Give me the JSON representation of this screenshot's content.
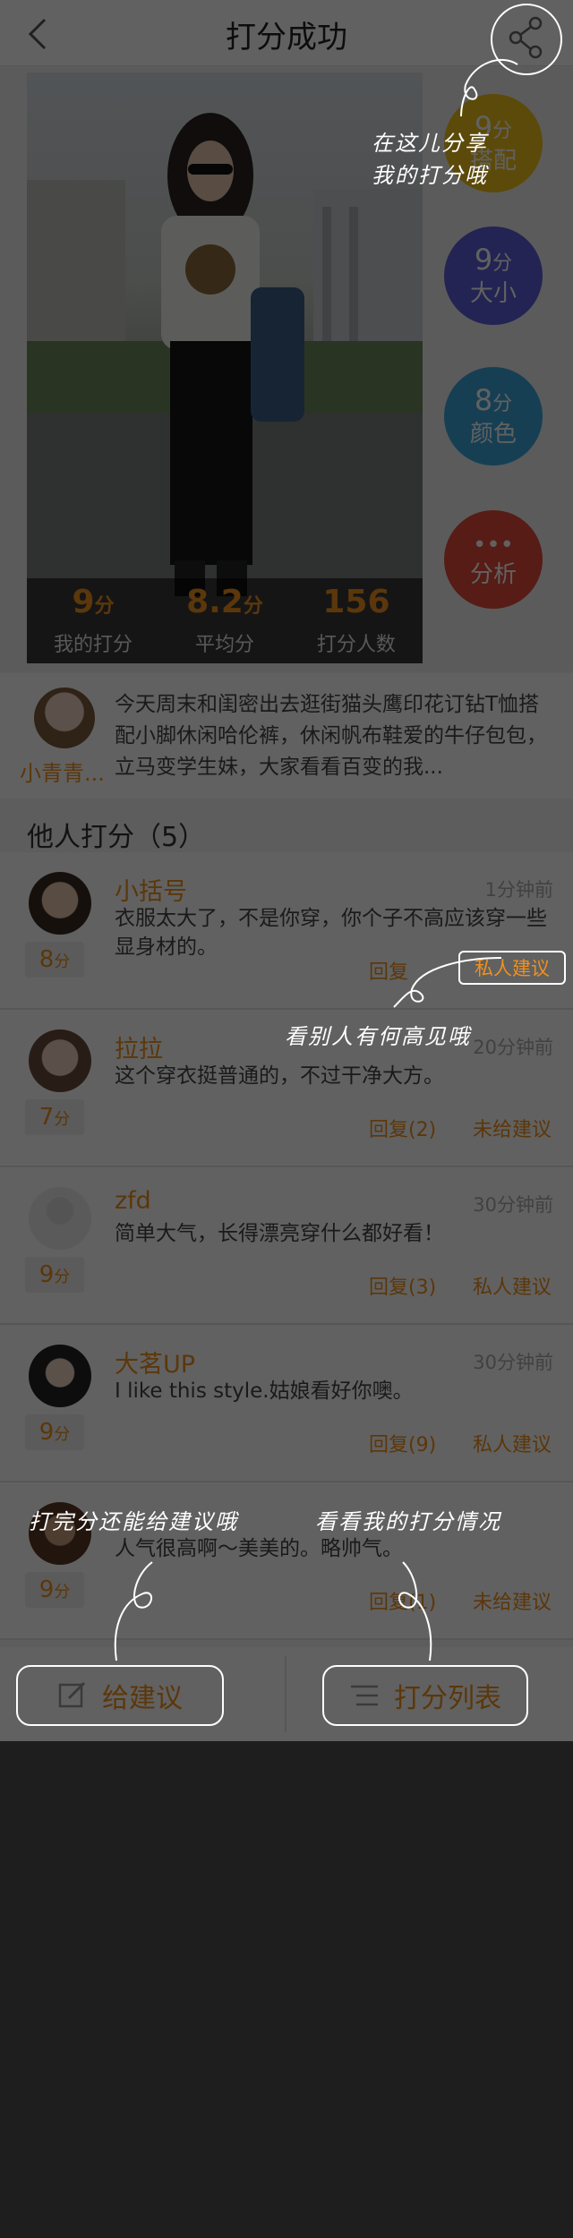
{
  "header": {
    "title": "打分成功"
  },
  "scores": [
    {
      "value": "9",
      "unit": "分",
      "label": "我的打分"
    },
    {
      "value": "8.2",
      "unit": "分",
      "label": "平均分"
    },
    {
      "value": "156",
      "unit": "",
      "label": "打分人数"
    }
  ],
  "side_scores": [
    {
      "value": "9",
      "unit": "分",
      "caption": "搭配",
      "color": "#f2c21b"
    },
    {
      "value": "9",
      "unit": "分",
      "caption": "大小",
      "color": "#5c60d9"
    },
    {
      "value": "8",
      "unit": "分",
      "caption": "颜色",
      "color": "#3ea5dc"
    },
    {
      "value": "•••",
      "unit": "",
      "caption": "分析",
      "color": "#e14a38"
    }
  ],
  "poster": {
    "name": "小青青...",
    "description": "今天周末和闺密出去逛街猫头鹰印花订钻T恤搭配小脚休闲哈伦裤，休闲帆布鞋爱的牛仔包包，立马变学生妹，大家看看百变的我..."
  },
  "section": {
    "title": "他人打分（5）"
  },
  "comments": [
    {
      "name": "小括号",
      "time": "1分钟前",
      "score": "8",
      "unit": "分",
      "text": "衣服太大了，不是你穿，你个子不高应该穿一些显身材的。",
      "reply": "回复",
      "advice": "私人建议"
    },
    {
      "name": "拉拉",
      "time": "20分钟前",
      "score": "7",
      "unit": "分",
      "text": "这个穿衣挺普通的，不过干净大方。",
      "reply": "回复(2)",
      "advice": "未给建议"
    },
    {
      "name": "zfd",
      "time": "30分钟前",
      "score": "9",
      "unit": "分",
      "text": "简单大气，长得漂亮穿什么都好看！",
      "reply": "回复(3)",
      "advice": "私人建议"
    },
    {
      "name": "大茗UP",
      "time": "30分钟前",
      "score": "9",
      "unit": "分",
      "text": "I like this style.姑娘看好你噢。",
      "reply": "回复(9)",
      "advice": "私人建议"
    },
    {
      "name": "",
      "time": "",
      "score": "9",
      "unit": "分",
      "text": "人气很高啊～美美的。略帅气。",
      "reply": "回复(1)",
      "advice": "未给建议"
    }
  ],
  "tabbar": {
    "advice_label": "给建议",
    "list_label": "打分列表"
  },
  "hints": {
    "share_line1": "在这儿分享",
    "share_line2": "我的打分哦",
    "advice": "看别人有何高见哦",
    "give_advice": "打完分还能给建议哦",
    "view_list": "看看我的打分情况"
  }
}
